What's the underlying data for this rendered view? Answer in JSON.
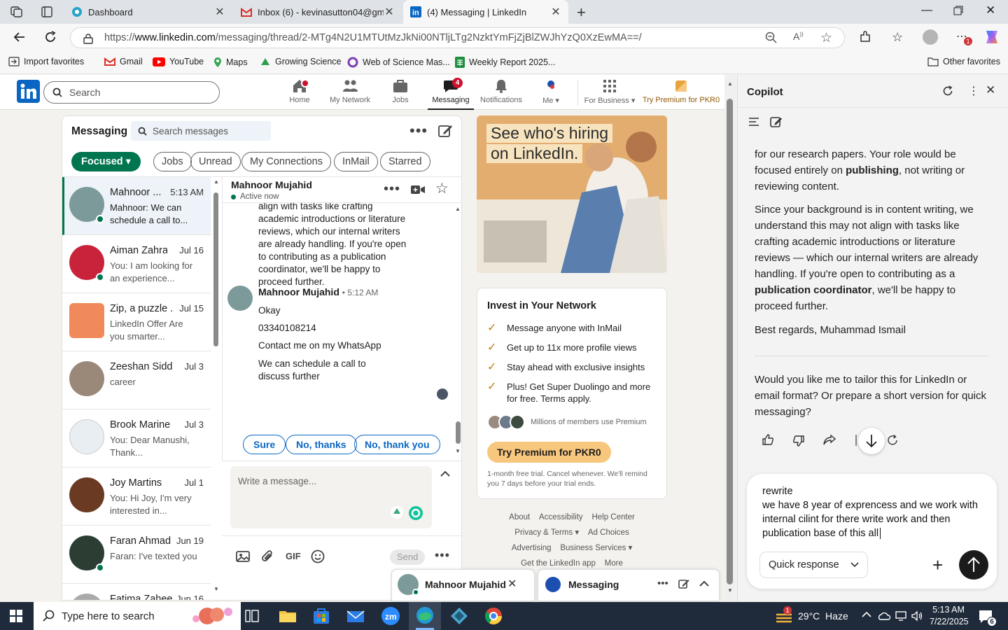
{
  "browser": {
    "tabs": [
      {
        "title": "Dashboard"
      },
      {
        "title": "Inbox (6) - kevinasutton04@gmail.com"
      },
      {
        "title": "(4) Messaging | LinkedIn"
      }
    ],
    "url_prefix": "https://",
    "url_domain": "www.linkedin.com",
    "url_rest": "/messaging/thread/2-MTg4N2U1MTUtMzJkNi00NTljLTg2NzktYmFjZjBlZWJhYzQ0XzEwMA==/",
    "ext_badge": "1",
    "favorites": [
      {
        "label": "Import favorites"
      },
      {
        "label": "Gmail"
      },
      {
        "label": "YouTube"
      },
      {
        "label": "Maps"
      },
      {
        "label": "Growing Science"
      },
      {
        "label": "Web of Science Mas..."
      },
      {
        "label": "Weekly Report 2025..."
      }
    ],
    "other_favorites": "Other favorites"
  },
  "linkedin": {
    "search_placeholder": "Search",
    "nav": {
      "home": "Home",
      "network": "My Network",
      "jobs": "Jobs",
      "messaging": "Messaging",
      "messaging_badge": "4",
      "notifications": "Notifications",
      "me": "Me",
      "business": "For Business",
      "premium": "Try Premium for PKR0"
    },
    "messaging": {
      "title": "Messaging",
      "search_placeholder": "Search messages",
      "filters": {
        "focused": "Focused",
        "items": [
          "Jobs",
          "Unread",
          "My Connections",
          "InMail",
          "Starred"
        ]
      },
      "conversations": [
        {
          "name": "Mahnoor ...",
          "date": "5:13 AM",
          "preview": "Mahnoor: We can schedule a call to...",
          "online": true,
          "color": "#7d9a9a"
        },
        {
          "name": "Aiman Zahra",
          "date": "Jul 16",
          "preview": "You: I am looking for an experience...",
          "online": true,
          "color": "#c8233a"
        },
        {
          "name": "Zip, a puzzle ...",
          "date": "Jul 15",
          "preview": "LinkedIn Offer Are you smarter...",
          "online": false,
          "color": "#f08a5a"
        },
        {
          "name": "Zeeshan Siddi...",
          "date": "Jul 3",
          "preview": "career",
          "online": false,
          "color": "#9a8878"
        },
        {
          "name": "Brook Marine ...",
          "date": "Jul 3",
          "preview": "You: Dear Manushi, Thank...",
          "online": false,
          "color": "#e8eef2"
        },
        {
          "name": "Joy Martins",
          "date": "Jul 1",
          "preview": "You: Hi Joy, I'm very interested in...",
          "online": false,
          "color": "#6a3b22"
        },
        {
          "name": "Faran Ahmad",
          "date": "Jun 19",
          "preview": "Faran: I've texted you",
          "online": true,
          "color": "#2c3e34"
        },
        {
          "name": "Fatima Zaheer",
          "date": "Jun 16",
          "preview": "",
          "online": false,
          "color": "#aaaaaa"
        }
      ],
      "thread": {
        "name": "Mahnoor Mujahid",
        "status": "Active now",
        "prev_text": "align with tasks like crafting academic introductions or literature reviews, which our internal writers are already handling. If you're open to contributing as a publication coordinator, we'll be happy to proceed further.",
        "sender": "Mahnoor Mujahid",
        "time": "• 5:12 AM",
        "lines": [
          "Okay",
          "03340108214",
          "Contact me on my WhatsApp",
          "We can schedule a call to discuss further"
        ],
        "quick_replies": [
          "Sure",
          "No, thanks",
          "No, thank you"
        ],
        "compose_placeholder": "Write a message...",
        "gif": "GIF",
        "send": "Send"
      }
    },
    "ad": {
      "line1": "See who's hiring",
      "line2": "on LinkedIn."
    },
    "premium": {
      "title": "Invest in Your Network",
      "items": [
        "Message anyone with InMail",
        "Get up to 11x more profile views",
        "Stay ahead with exclusive insights",
        "Plus! Get Super Duolingo and more for free. Terms apply."
      ],
      "members": "Millions of members use Premium",
      "cta": "Try Premium for PKR0",
      "note": "1-month free trial. Cancel whenever. We'll remind you 7 days before your trial ends."
    },
    "footer": {
      "row1": [
        "About",
        "Accessibility",
        "Help Center"
      ],
      "row2": [
        "Privacy & Terms",
        "Ad Choices"
      ],
      "row3": [
        "Advertising",
        "Business Services"
      ],
      "row4": [
        "Get the LinkedIn app",
        "More"
      ]
    },
    "popups": {
      "chat_name": "Mahnoor Mujahid",
      "messaging": "Messaging"
    }
  },
  "copilot": {
    "title": "Copilot",
    "p1_a": "for our research papers. Your role would be focused entirely on ",
    "p1_b": "publishing",
    "p1_c": ", not writing or reviewing content.",
    "p2_a": "Since your background is in content writing, we understand this may not align with tasks like crafting academic introductions or literature reviews — which our internal writers are already handling. If you're open to contributing as a ",
    "p2_b": "publication coordinator",
    "p2_c": ", we'll be happy to proceed further.",
    "p3": "Best regards, Muhammad Ismail",
    "p4": "Would you like me to tailor this for LinkedIn or email format? Or prepare a short version for quick messaging?",
    "input_line1": "rewrite",
    "input_line2": "we have 8 year of exprencess and we work with internal cilint for there write work and then publication base of this all",
    "quick_response": "Quick response"
  },
  "taskbar": {
    "search_placeholder": "Type here to search",
    "weather": "29°C  Haze",
    "weather_badge": "1",
    "time": "5:13 AM",
    "date": "7/22/2025",
    "notif_count": "6"
  }
}
